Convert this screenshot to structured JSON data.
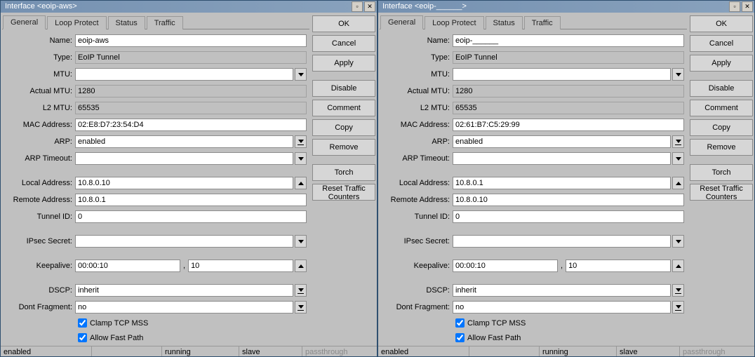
{
  "windows": [
    {
      "title": "Interface <eoip-aws>",
      "tabs": [
        "General",
        "Loop Protect",
        "Status",
        "Traffic"
      ],
      "buttons": [
        "OK",
        "Cancel",
        "Apply",
        "Disable",
        "Comment",
        "Copy",
        "Remove",
        "Torch",
        "Reset Traffic Counters"
      ],
      "labels": {
        "name": "Name:",
        "type": "Type:",
        "mtu": "MTU:",
        "amtu": "Actual MTU:",
        "l2mtu": "L2 MTU:",
        "mac": "MAC Address:",
        "arp": "ARP:",
        "arpto": "ARP Timeout:",
        "laddr": "Local Address:",
        "raddr": "Remote Address:",
        "tid": "Tunnel ID:",
        "ipsec": "IPsec Secret:",
        "keep": "Keepalive:",
        "dscp": "DSCP:",
        "dfrag": "Dont Fragment:"
      },
      "values": {
        "name": "eoip-aws",
        "type": "EoIP Tunnel",
        "mtu": "",
        "amtu": "1280",
        "l2mtu": "65535",
        "mac": "02:E8:D7:23:54:D4",
        "arp": "enabled",
        "arpto": "",
        "laddr": "10.8.0.10",
        "raddr": "10.8.0.1",
        "tid": "0",
        "ipsec": "",
        "keep1": "00:00:10",
        "keep2": "10",
        "dscp": "inherit",
        "dfrag": "no"
      },
      "checks": {
        "clamp": "Clamp TCP MSS",
        "fast": "Allow Fast Path"
      },
      "status": [
        "enabled",
        "",
        "running",
        "slave",
        "passthrough"
      ]
    },
    {
      "title": "Interface <eoip-______>",
      "tabs": [
        "General",
        "Loop Protect",
        "Status",
        "Traffic"
      ],
      "buttons": [
        "OK",
        "Cancel",
        "Apply",
        "Disable",
        "Comment",
        "Copy",
        "Remove",
        "Torch",
        "Reset Traffic Counters"
      ],
      "labels": {
        "name": "Name:",
        "type": "Type:",
        "mtu": "MTU:",
        "amtu": "Actual MTU:",
        "l2mtu": "L2 MTU:",
        "mac": "MAC Address:",
        "arp": "ARP:",
        "arpto": "ARP Timeout:",
        "laddr": "Local Address:",
        "raddr": "Remote Address:",
        "tid": "Tunnel ID:",
        "ipsec": "IPsec Secret:",
        "keep": "Keepalive:",
        "dscp": "DSCP:",
        "dfrag": "Dont Fragment:"
      },
      "values": {
        "name": "eoip-______",
        "type": "EoIP Tunnel",
        "mtu": "",
        "amtu": "1280",
        "l2mtu": "65535",
        "mac": "02:61:B7:C5:29:99",
        "arp": "enabled",
        "arpto": "",
        "laddr": "10.8.0.1",
        "raddr": "10.8.0.10",
        "tid": "0",
        "ipsec": "",
        "keep1": "00:00:10",
        "keep2": "10",
        "dscp": "inherit",
        "dfrag": "no"
      },
      "checks": {
        "clamp": "Clamp TCP MSS",
        "fast": "Allow Fast Path"
      },
      "status": [
        "enabled",
        "",
        "running",
        "slave",
        "passthrough"
      ]
    }
  ]
}
